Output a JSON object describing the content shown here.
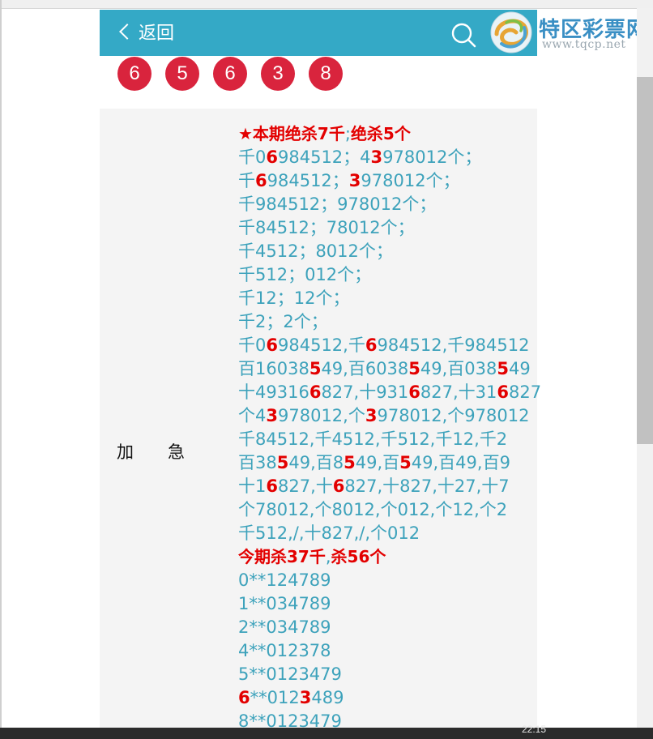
{
  "header": {
    "back_label": "返回",
    "logo_name": "特区彩票网",
    "logo_url": "www.tqcp.net",
    "accent_color": "#34a9c6"
  },
  "balls": [
    "6",
    "5",
    "6",
    "3",
    "8"
  ],
  "side_label": "加　　急",
  "content_lines": [
    [
      {
        "t": "★本期绝杀7千",
        "c": "head"
      },
      {
        "t": ";",
        "c": "plain"
      },
      {
        "t": "绝杀5个",
        "c": "head"
      }
    ],
    [
      {
        "t": "千0",
        "c": "plain"
      },
      {
        "t": "6",
        "c": "red"
      },
      {
        "t": "984512；4",
        "c": "plain"
      },
      {
        "t": "3",
        "c": "red"
      },
      {
        "t": "978012个；",
        "c": "plain"
      }
    ],
    [
      {
        "t": "千",
        "c": "plain"
      },
      {
        "t": "6",
        "c": "red"
      },
      {
        "t": "984512；",
        "c": "plain"
      },
      {
        "t": "3",
        "c": "red"
      },
      {
        "t": "978012个；",
        "c": "plain"
      }
    ],
    [
      {
        "t": "千984512；978012个；",
        "c": "plain"
      }
    ],
    [
      {
        "t": "千84512；78012个；",
        "c": "plain"
      }
    ],
    [
      {
        "t": "千4512；8012个；",
        "c": "plain"
      }
    ],
    [
      {
        "t": "千512；012个；",
        "c": "plain"
      }
    ],
    [
      {
        "t": "千12；12个；",
        "c": "plain"
      }
    ],
    [
      {
        "t": "千2；2个；",
        "c": "plain"
      }
    ],
    [
      {
        "t": "千0",
        "c": "plain"
      },
      {
        "t": "6",
        "c": "red"
      },
      {
        "t": "984512,千",
        "c": "plain"
      },
      {
        "t": "6",
        "c": "red"
      },
      {
        "t": "984512,千984512",
        "c": "plain"
      }
    ],
    [
      {
        "t": "百16038",
        "c": "plain"
      },
      {
        "t": "5",
        "c": "red"
      },
      {
        "t": "49,百6038",
        "c": "plain"
      },
      {
        "t": "5",
        "c": "red"
      },
      {
        "t": "49,百038",
        "c": "plain"
      },
      {
        "t": "5",
        "c": "red"
      },
      {
        "t": "49",
        "c": "plain"
      }
    ],
    [
      {
        "t": "十49316",
        "c": "plain"
      },
      {
        "t": "6",
        "c": "red"
      },
      {
        "t": "827,十931",
        "c": "plain"
      },
      {
        "t": "6",
        "c": "red"
      },
      {
        "t": "827,十31",
        "c": "plain"
      },
      {
        "t": "6",
        "c": "red"
      },
      {
        "t": "827",
        "c": "plain"
      }
    ],
    [
      {
        "t": "个4",
        "c": "plain"
      },
      {
        "t": "3",
        "c": "red"
      },
      {
        "t": "978012,个",
        "c": "plain"
      },
      {
        "t": "3",
        "c": "red"
      },
      {
        "t": "978012,个978012",
        "c": "plain"
      }
    ],
    [
      {
        "t": "千84512,千4512,千512,千12,千2",
        "c": "plain"
      }
    ],
    [
      {
        "t": "百38",
        "c": "plain"
      },
      {
        "t": "5",
        "c": "red"
      },
      {
        "t": "49,百8",
        "c": "plain"
      },
      {
        "t": "5",
        "c": "red"
      },
      {
        "t": "49,百",
        "c": "plain"
      },
      {
        "t": "5",
        "c": "red"
      },
      {
        "t": "49,百49,百9",
        "c": "plain"
      }
    ],
    [
      {
        "t": "十1",
        "c": "plain"
      },
      {
        "t": "6",
        "c": "red"
      },
      {
        "t": "827,十",
        "c": "plain"
      },
      {
        "t": "6",
        "c": "red"
      },
      {
        "t": "827,十827,十27,十7",
        "c": "plain"
      }
    ],
    [
      {
        "t": "个78012,个8012,个012,个12,个2",
        "c": "plain"
      }
    ],
    [
      {
        "t": "千512,/,十827,/,个012",
        "c": "plain"
      }
    ],
    [
      {
        "t": "今期杀37千",
        "c": "head"
      },
      {
        "t": ",",
        "c": "plain"
      },
      {
        "t": "杀56个",
        "c": "head"
      }
    ],
    [
      {
        "t": "0**124789",
        "c": "plain"
      }
    ],
    [
      {
        "t": "1**034789",
        "c": "plain"
      }
    ],
    [
      {
        "t": "2**034789",
        "c": "plain"
      }
    ],
    [
      {
        "t": "4**012378",
        "c": "plain"
      }
    ],
    [
      {
        "t": "5**0123479",
        "c": "plain"
      }
    ],
    [
      {
        "t": "6",
        "c": "red"
      },
      {
        "t": "**012",
        "c": "plain"
      },
      {
        "t": "3",
        "c": "red"
      },
      {
        "t": "489",
        "c": "plain"
      }
    ],
    [
      {
        "t": "8**0123479",
        "c": "plain"
      }
    ]
  ],
  "taskbar_time": "22:15"
}
